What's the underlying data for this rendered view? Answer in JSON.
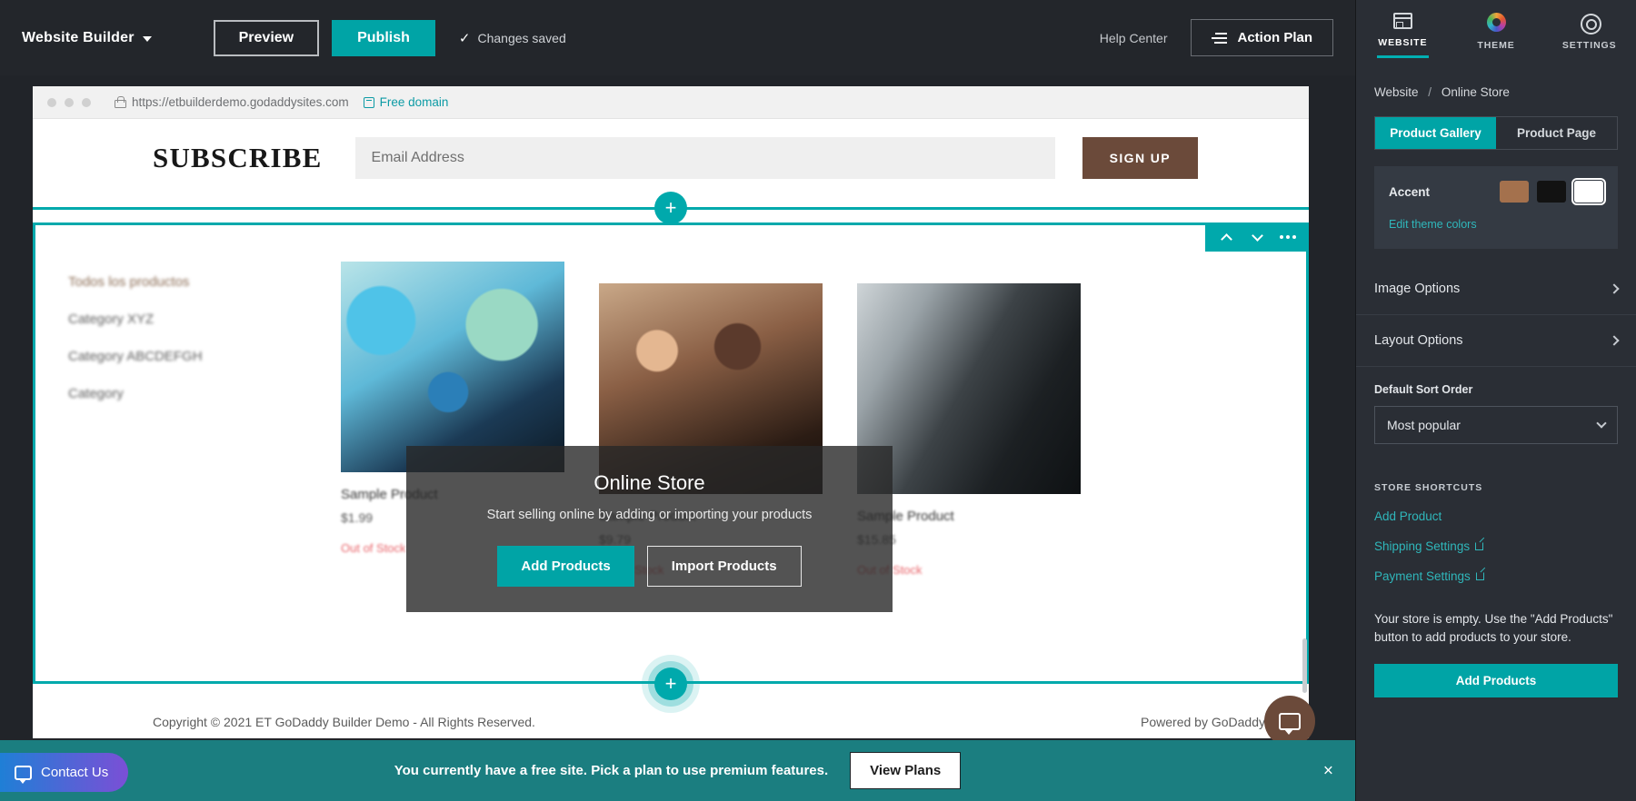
{
  "topbar": {
    "brand": "Website Builder",
    "preview_label": "Preview",
    "publish_label": "Publish",
    "saved_label": "Changes saved",
    "saved_check": "✓",
    "help_label": "Help Center",
    "action_plan_label": "Action Plan"
  },
  "browser": {
    "url": "https://etbuilderdemo.godaddysites.com",
    "free_domain_label": "Free domain"
  },
  "site": {
    "subscribe_title": "SUBSCRIBE",
    "email_placeholder": "Email Address",
    "signup_label": "SIGN UP",
    "categories": [
      "Todos los productos",
      "Category XYZ",
      "Category ABCDEFGH",
      "Category"
    ],
    "products": [
      {
        "name": "Sample Product",
        "price": "$1.99",
        "stock": "Out of Stock"
      },
      {
        "name": "Sample Product",
        "price": "$9.79",
        "stock": "Out of Stock"
      },
      {
        "name": "Sample Product",
        "price": "$15.85",
        "stock": "Out of Stock"
      }
    ],
    "footer_copyright": "Copyright © 2021 ET GoDaddy Builder Demo - All Rights Reserved.",
    "footer_powered": "Powered by GoDaddy"
  },
  "store_overlay": {
    "title": "Online Store",
    "subtitle": "Start selling online by adding or importing your products",
    "add_label": "Add Products",
    "import_label": "Import Products"
  },
  "section_toolbar": {
    "move_up": "move-up",
    "move_down": "move-down",
    "more": "more-options",
    "add_section": "+"
  },
  "plan_banner": {
    "contact_label": "Contact Us",
    "message": "You currently have a free site. Pick a plan to use premium features.",
    "view_plans_label": "View Plans",
    "close_label": "×"
  },
  "panel": {
    "tabs": [
      {
        "label": "WEBSITE",
        "icon": "website-icon",
        "active": true
      },
      {
        "label": "THEME",
        "icon": "theme-icon",
        "active": false
      },
      {
        "label": "SETTINGS",
        "icon": "gear-icon",
        "active": false
      }
    ],
    "breadcrumb_root": "Website",
    "breadcrumb_sep": "/",
    "breadcrumb_current": "Online Store",
    "segments": [
      {
        "label": "Product Gallery",
        "active": true
      },
      {
        "label": "Product Page",
        "active": false
      }
    ],
    "accent": {
      "label": "Accent",
      "swatches": [
        "#a4714d",
        "#121212",
        "#ffffff"
      ],
      "selected_index": 2,
      "edit_link": "Edit theme colors"
    },
    "options": [
      {
        "label": "Image Options"
      },
      {
        "label": "Layout Options"
      }
    ],
    "sort": {
      "label": "Default Sort Order",
      "value": "Most popular"
    },
    "shortcuts_heading": "STORE SHORTCUTS",
    "shortcuts": [
      {
        "label": "Add Product",
        "external": false
      },
      {
        "label": "Shipping Settings",
        "external": true
      },
      {
        "label": "Payment Settings",
        "external": true
      }
    ],
    "empty_note": "Your store is empty. Use the \"Add Products\" button to add products to your store.",
    "add_products_label": "Add Products"
  },
  "colors": {
    "teal": "#00a4a6",
    "panel_bg": "#2a2e35",
    "topbar_bg": "#23262b",
    "banner_bg": "#1b7e80",
    "brown": "#6b4a3a"
  }
}
